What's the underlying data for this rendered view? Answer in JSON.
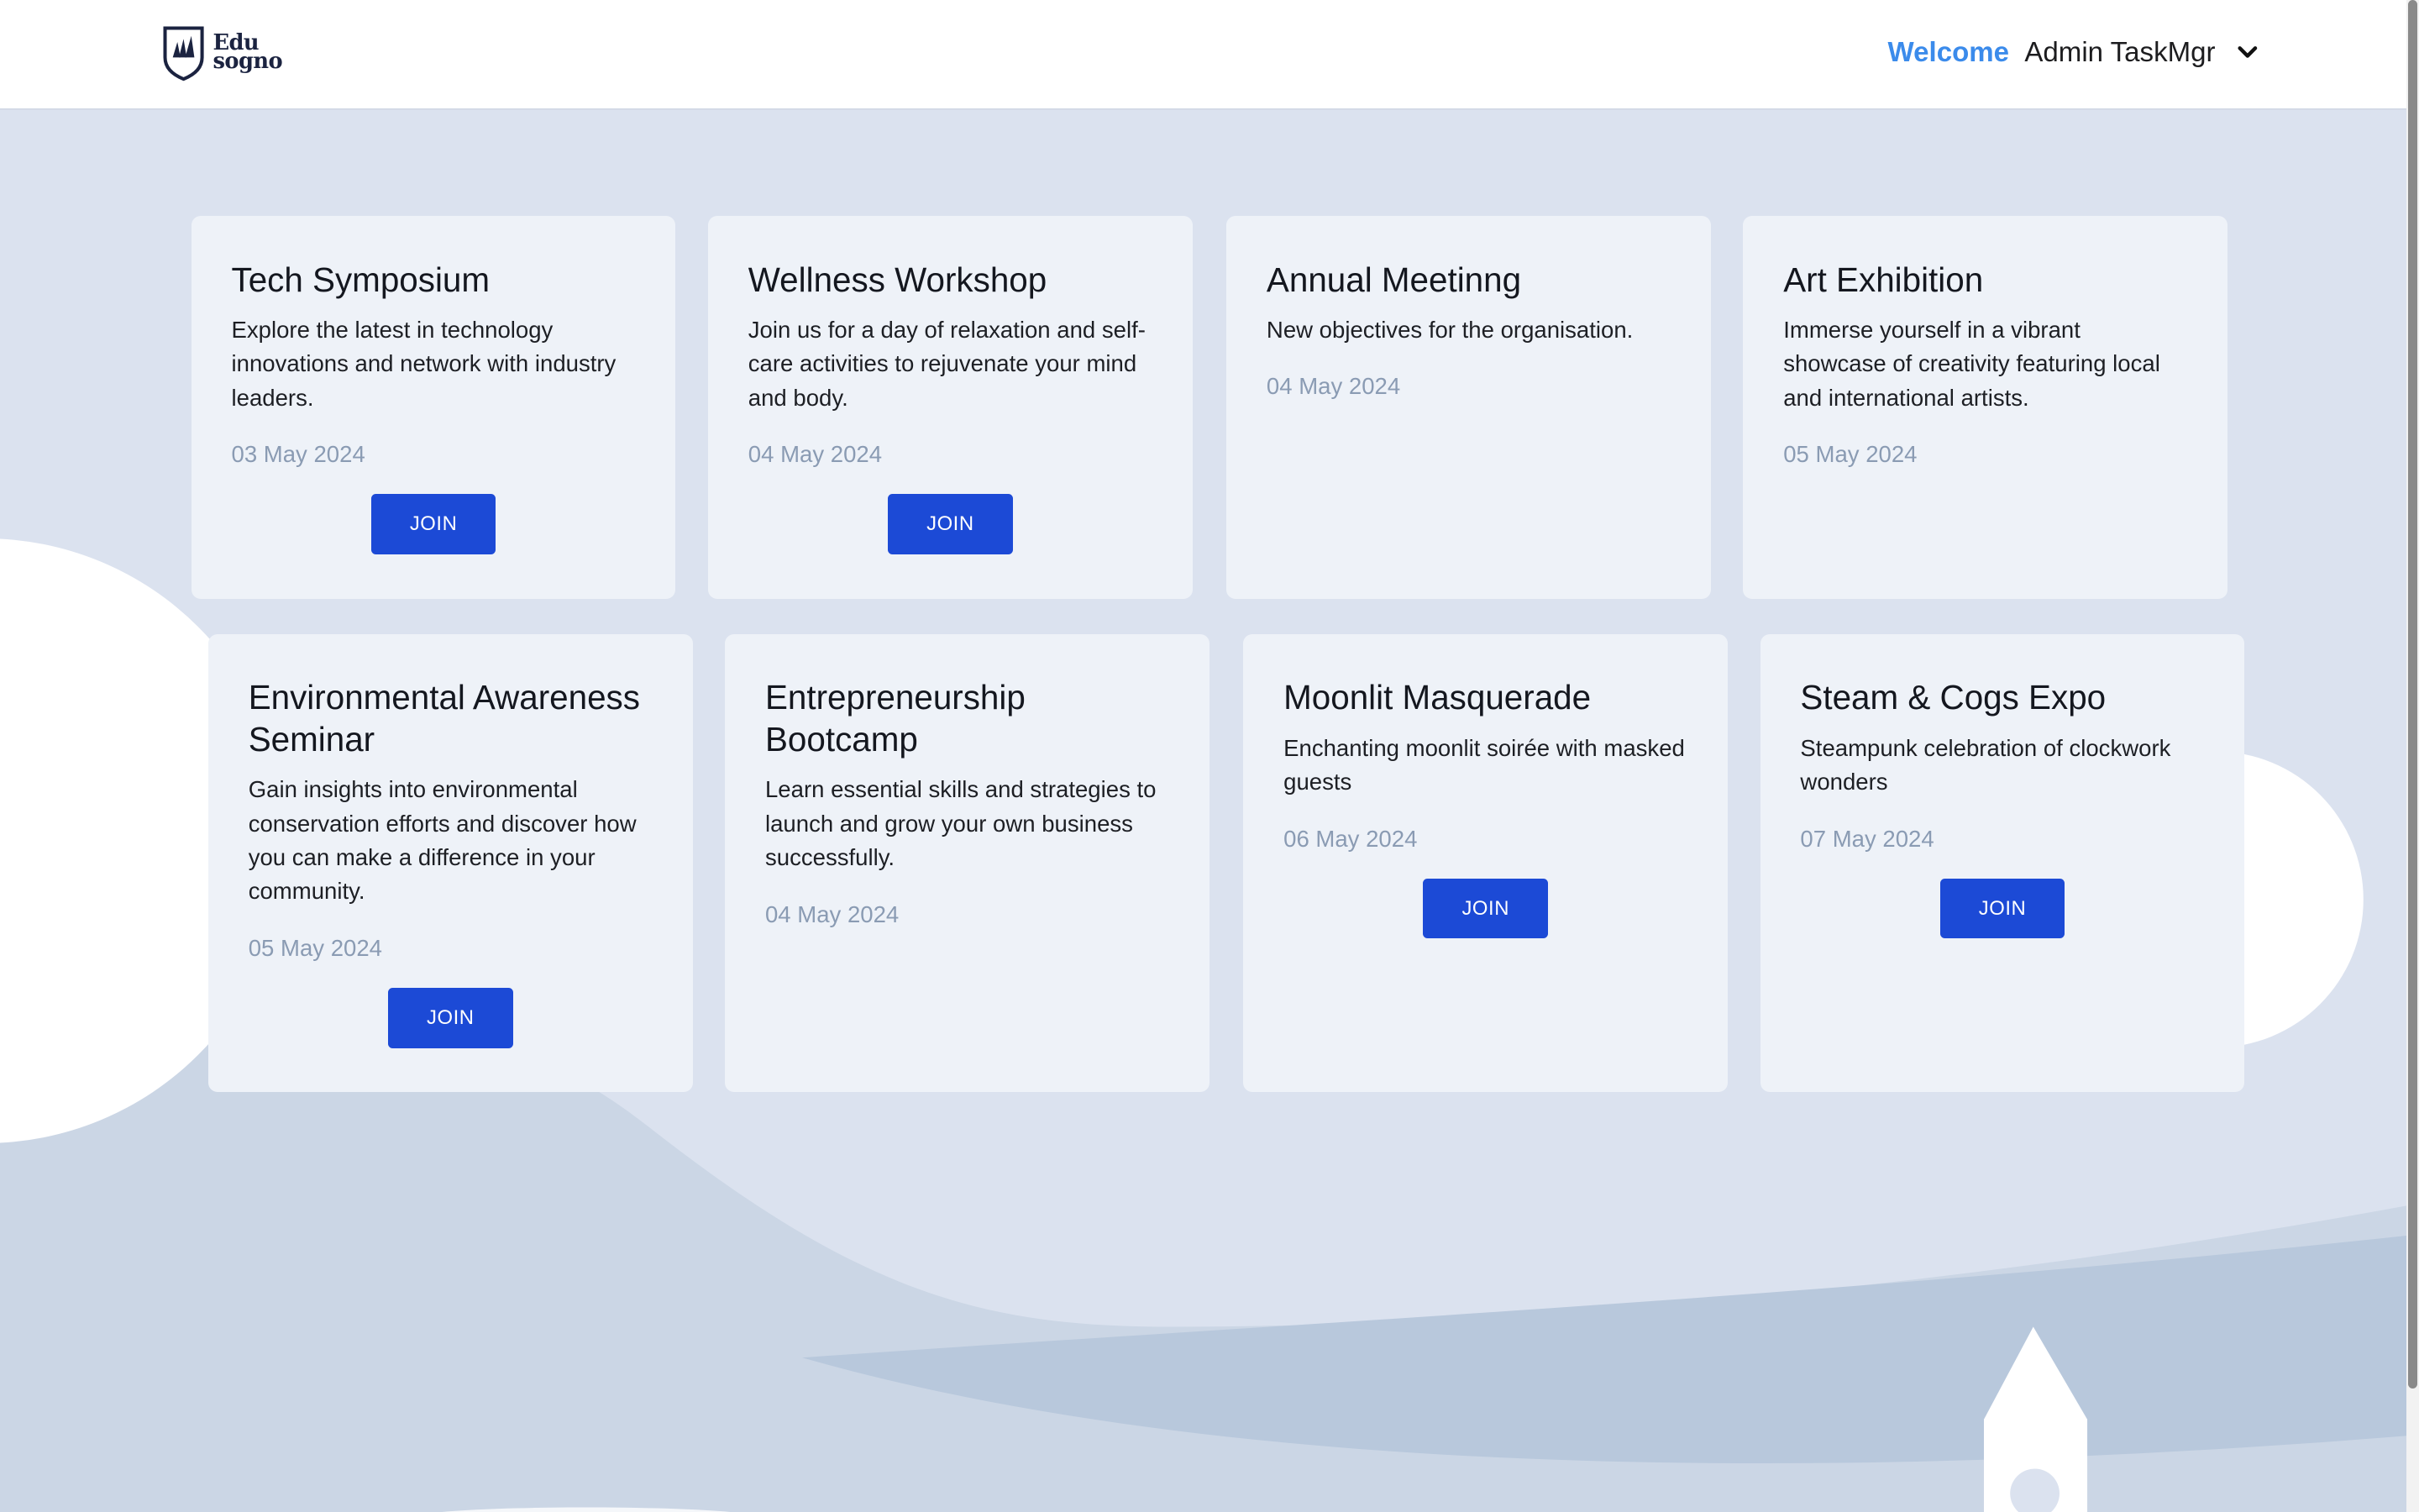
{
  "header": {
    "logo_line1": "Edu",
    "logo_line2": "sogno",
    "welcome": "Welcome",
    "username": "Admin TaskMgr"
  },
  "events": [
    {
      "title": "Tech Symposium",
      "description": "Explore the latest in technology innovations and network with industry leaders.",
      "date": "03 May 2024",
      "join_label": "JOIN"
    },
    {
      "title": "Wellness Workshop",
      "description": "Join us for a day of relaxation and self-care activities to rejuvenate your mind and body.",
      "date": "04 May 2024",
      "join_label": "JOIN"
    },
    {
      "title": "Annual Meetinng",
      "description": "New objectives for the organisation.",
      "date": "04 May 2024"
    },
    {
      "title": "Art Exhibition",
      "description": "Immerse yourself in a vibrant showcase of creativity featuring local and international artists.",
      "date": "05 May 2024"
    },
    {
      "title": "Environmental Awareness Seminar",
      "description": "Gain insights into environmental conservation efforts and discover how you can make a difference in your community.",
      "date": "05 May 2024",
      "join_label": "JOIN"
    },
    {
      "title": "Entrepreneurship Bootcamp",
      "description": "Learn essential skills and strategies to launch and grow your own business successfully.",
      "date": "04 May 2024"
    },
    {
      "title": "Moonlit Masquerade",
      "description": "Enchanting moonlit soirée with masked guests",
      "date": "06 May 2024",
      "join_label": "JOIN"
    },
    {
      "title": "Steam & Cogs Expo",
      "description": "Steampunk celebration of clockwork wonders",
      "date": "07 May 2024",
      "join_label": "JOIN"
    }
  ],
  "colors": {
    "accent": "#1c4ad6",
    "welcome": "#3b8beb",
    "background": "#dbe2ef",
    "card": "#eef2f8",
    "date_text": "#8a9bb3"
  },
  "icons": {
    "logo": "book-shield-icon",
    "user_menu": "chevron-down-icon"
  }
}
